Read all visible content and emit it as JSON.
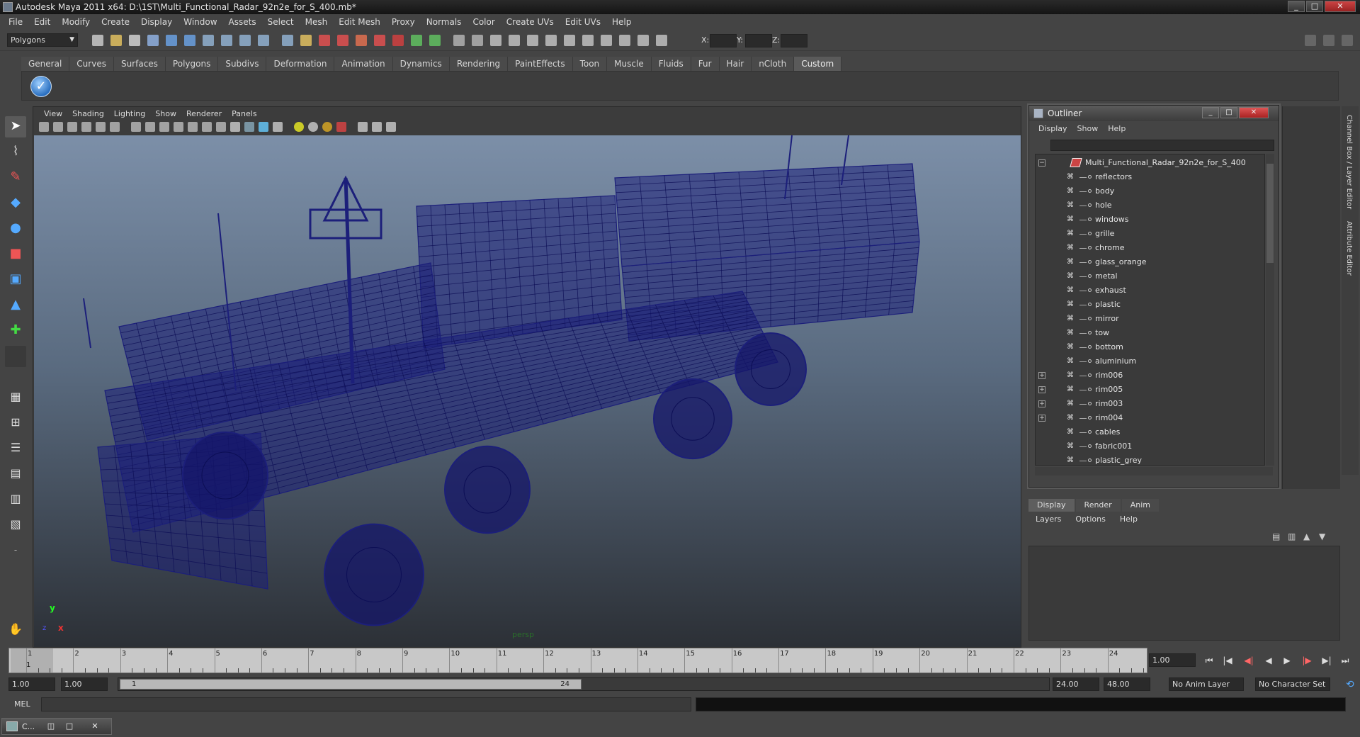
{
  "window": {
    "title": "Autodesk Maya 2011 x64: D:\\1ST\\Multi_Functional_Radar_92n2e_for_S_400.mb*",
    "minimize": "_",
    "maximize": "□",
    "close": "✕"
  },
  "menubar": [
    "File",
    "Edit",
    "Modify",
    "Create",
    "Display",
    "Window",
    "Assets",
    "Select",
    "Mesh",
    "Edit Mesh",
    "Proxy",
    "Normals",
    "Color",
    "Create UVs",
    "Edit UVs",
    "Help"
  ],
  "statusline": {
    "mode": "Polygons",
    "x_label": "X:",
    "y_label": "Y:",
    "z_label": "Z:"
  },
  "shelf": {
    "tabs": [
      "General",
      "Curves",
      "Surfaces",
      "Polygons",
      "Subdivs",
      "Deformation",
      "Animation",
      "Dynamics",
      "Rendering",
      "PaintEffects",
      "Toon",
      "Muscle",
      "Fluids",
      "Fur",
      "Hair",
      "nCloth",
      "Custom"
    ],
    "active_tab": "Custom",
    "check_glyph": "✓"
  },
  "viewport": {
    "menu": [
      "View",
      "Shading",
      "Lighting",
      "Show",
      "Renderer",
      "Panels"
    ],
    "camera_label": "persp",
    "axis_x": "x",
    "axis_y": "y",
    "axis_z": "z",
    "wire_color": "#1c1f7a"
  },
  "outliner": {
    "title": "Outliner",
    "menu": [
      "Display",
      "Show",
      "Help"
    ],
    "root": "Multi_Functional_Radar_92n2e_for_S_400",
    "items": [
      {
        "label": "reflectors",
        "expandable": false
      },
      {
        "label": "body",
        "expandable": false
      },
      {
        "label": "hole",
        "expandable": false
      },
      {
        "label": "windows",
        "expandable": false
      },
      {
        "label": "grille",
        "expandable": false
      },
      {
        "label": "chrome",
        "expandable": false
      },
      {
        "label": "glass_orange",
        "expandable": false
      },
      {
        "label": "metal",
        "expandable": false
      },
      {
        "label": "exhaust",
        "expandable": false
      },
      {
        "label": "plastic",
        "expandable": false
      },
      {
        "label": "mirror",
        "expandable": false
      },
      {
        "label": "tow",
        "expandable": false
      },
      {
        "label": "bottom",
        "expandable": false
      },
      {
        "label": "aluminium",
        "expandable": false
      },
      {
        "label": "rim006",
        "expandable": true
      },
      {
        "label": "rim005",
        "expandable": true
      },
      {
        "label": "rim003",
        "expandable": true
      },
      {
        "label": "rim004",
        "expandable": true
      },
      {
        "label": "cables",
        "expandable": false
      },
      {
        "label": "fabric001",
        "expandable": false
      },
      {
        "label": "plastic_grey",
        "expandable": false
      }
    ]
  },
  "layer_editor": {
    "tabs": [
      "Display",
      "Render",
      "Anim"
    ],
    "active_tab": "Display",
    "menu": [
      "Layers",
      "Options",
      "Help"
    ]
  },
  "channel_box": {
    "vertical_tab_1": "Channel Box / Layer Editor",
    "vertical_tab_2": "Attribute Editor"
  },
  "timeslider": {
    "ticks": [
      "1",
      "2",
      "3",
      "4",
      "5",
      "6",
      "7",
      "8",
      "9",
      "10",
      "11",
      "12",
      "13",
      "14",
      "15",
      "16",
      "17",
      "18",
      "19",
      "20",
      "21",
      "22",
      "23",
      "24"
    ],
    "current_frame": "1",
    "current_frame_field": "1.00"
  },
  "playback": {
    "go_start": "⏮",
    "step_back_key": "|◀",
    "step_back": "◀|",
    "play_back": "◀",
    "play_forward": "▶",
    "step_forward": "|▶",
    "step_forward_key": "▶|",
    "go_end": "⏭"
  },
  "range": {
    "start_time": "1.00",
    "playback_start": "1.00",
    "thumb_start": "1",
    "thumb_end": "24",
    "playback_end": "24.00",
    "end_time": "48.00",
    "anim_layer": "No Anim Layer",
    "character_set": "No Character Set"
  },
  "cmdline": {
    "label": "MEL"
  },
  "helpline": {
    "minimized_label": "C..."
  }
}
